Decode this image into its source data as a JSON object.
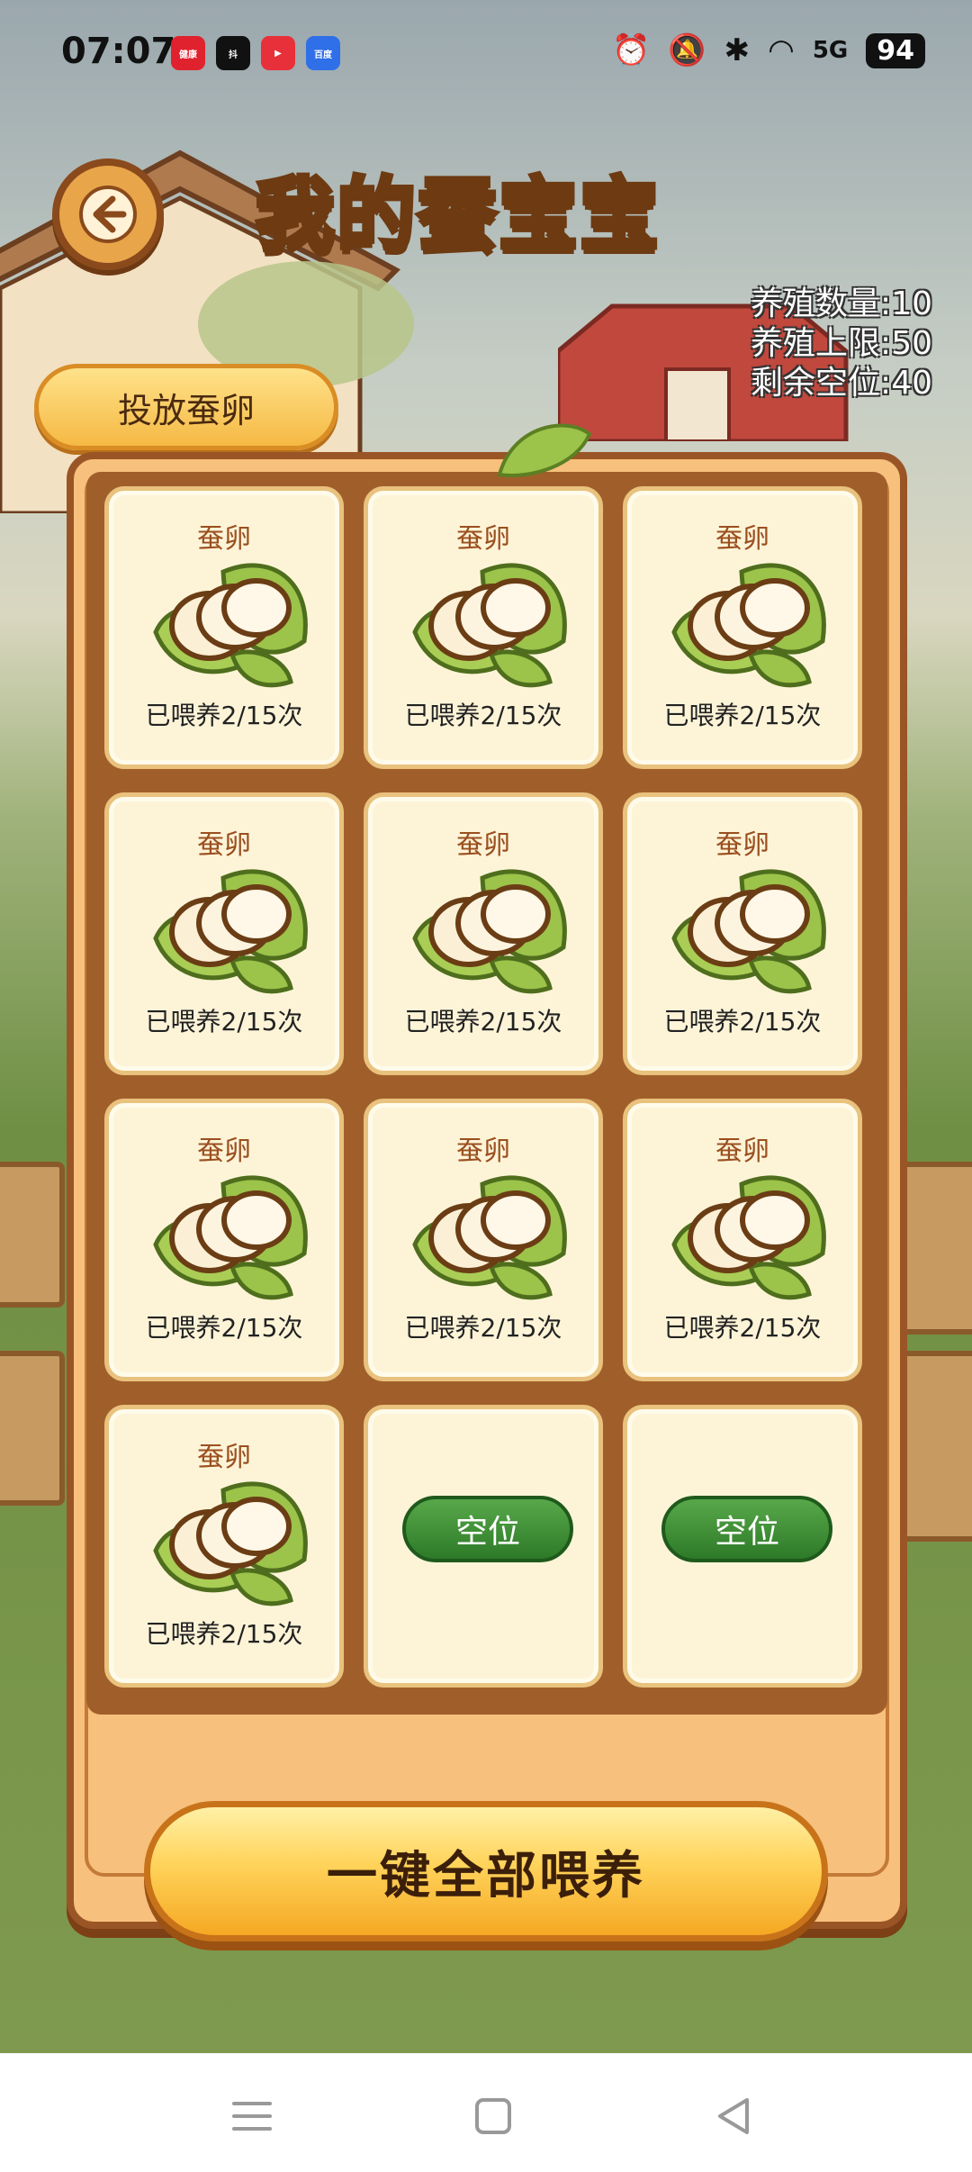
{
  "status_bar": {
    "time": "07:07",
    "apps": [
      {
        "icon": "health-app-icon",
        "label": "健康",
        "color": "#e0222e"
      },
      {
        "icon": "tiktok-app-icon",
        "label": "抖",
        "color": "#111111"
      },
      {
        "icon": "video-app-icon",
        "label": "▶",
        "color": "#e8303a"
      },
      {
        "icon": "baidu-app-icon",
        "label": "百度",
        "color": "#2f6fe8"
      }
    ],
    "network": "5G",
    "battery": "94"
  },
  "header": {
    "title": "我的蚕宝宝"
  },
  "stats": {
    "count_label": "养殖数量:",
    "count_value": "10",
    "limit_label": "养殖上限:",
    "limit_value": "50",
    "free_label": "剩余空位:",
    "free_value": "40"
  },
  "place_button": "投放蚕卵",
  "slots": [
    {
      "type": "egg",
      "name": "蚕卵",
      "feed": "已喂养2/15次"
    },
    {
      "type": "egg",
      "name": "蚕卵",
      "feed": "已喂养2/15次"
    },
    {
      "type": "egg",
      "name": "蚕卵",
      "feed": "已喂养2/15次"
    },
    {
      "type": "egg",
      "name": "蚕卵",
      "feed": "已喂养2/15次"
    },
    {
      "type": "egg",
      "name": "蚕卵",
      "feed": "已喂养2/15次"
    },
    {
      "type": "egg",
      "name": "蚕卵",
      "feed": "已喂养2/15次"
    },
    {
      "type": "egg",
      "name": "蚕卵",
      "feed": "已喂养2/15次"
    },
    {
      "type": "egg",
      "name": "蚕卵",
      "feed": "已喂养2/15次"
    },
    {
      "type": "egg",
      "name": "蚕卵",
      "feed": "已喂养2/15次"
    },
    {
      "type": "egg",
      "name": "蚕卵",
      "feed": "已喂养2/15次"
    },
    {
      "type": "empty",
      "label": "空位"
    },
    {
      "type": "empty",
      "label": "空位"
    }
  ],
  "feed_all_button": "一键全部喂养",
  "colors": {
    "accent": "#ffd34d",
    "empty_green": "#2d7a28",
    "wood": "#9a5526"
  }
}
